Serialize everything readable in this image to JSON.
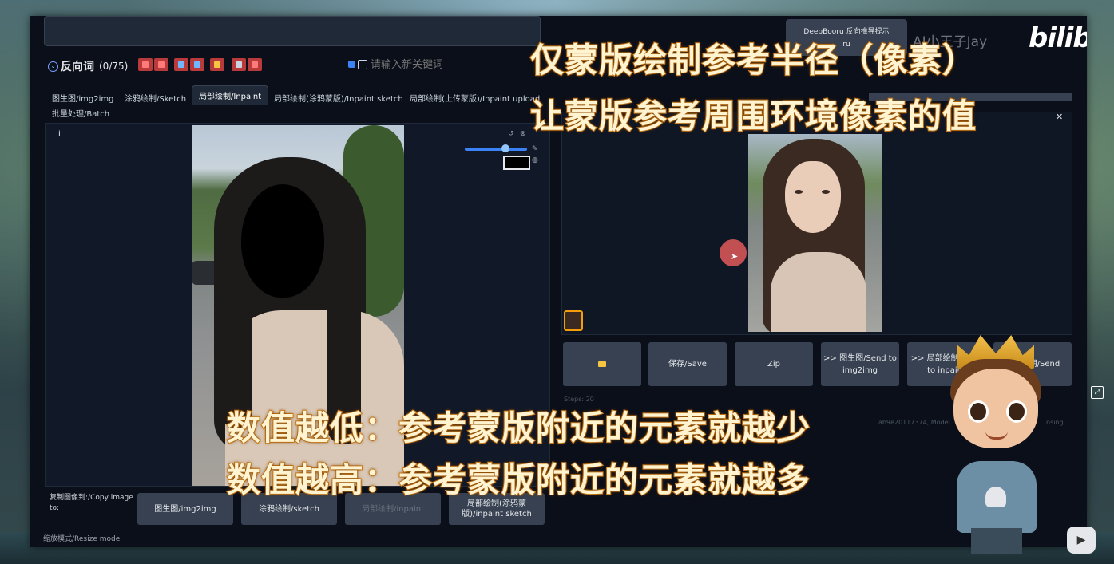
{
  "overlay": {
    "line1": "仅蒙版绘制参考半径（像素）",
    "line2": "让蒙版参考周围环境像素的值",
    "line3": "数值越低：参考蒙版附近的元素就越少",
    "line4": "数值越高：参考蒙版附近的元素就越多"
  },
  "watermark": {
    "brand": "AI小王子Jay",
    "platform": "bilibili"
  },
  "deepbooru": {
    "line1": "DeepBooru 反向推导提示",
    "line2": "ru"
  },
  "negative": {
    "title": "反向词",
    "count": "(0/75)",
    "keyword_placeholder": "请输入新关键词"
  },
  "tabs": [
    {
      "label": "图生图/img2img"
    },
    {
      "label": "涂鸦绘制/Sketch"
    },
    {
      "label": "局部绘制/Inpaint"
    },
    {
      "label": "局部绘制(涂鸦蒙版)/Inpaint sketch"
    },
    {
      "label": "局部绘制(上传蒙版)/Inpaint upload"
    },
    {
      "label": "批量处理/Batch"
    }
  ],
  "canvas": {
    "info": "i"
  },
  "copy": {
    "label": "复制图像到:/Copy image to:",
    "buttons": [
      {
        "label": "图生图/img2img"
      },
      {
        "label": "涂鸦绘制/sketch"
      },
      {
        "label": "局部绘制/inpaint"
      },
      {
        "label": "局部绘制(涂鸦蒙版)/inpaint sketch"
      }
    ],
    "resize_label": "缩放模式/Resize mode"
  },
  "output": {
    "buttons": [
      {
        "label": ""
      },
      {
        "label": "保存/Save"
      },
      {
        "label": "Zip"
      },
      {
        "label": ">> 图生图/Send to img2img"
      },
      {
        "label": ">> 局部绘制/Send to inpaint"
      },
      {
        "label": ">> 后期/Send"
      }
    ],
    "faint1": "Steps: 20",
    "faint2": "ab9e20117374, Model",
    "faint3": "nsing"
  },
  "colors": {
    "overlay_fill": "#fff4cf",
    "overlay_stroke": "#e08a1e",
    "accent": "#3b82f6"
  }
}
